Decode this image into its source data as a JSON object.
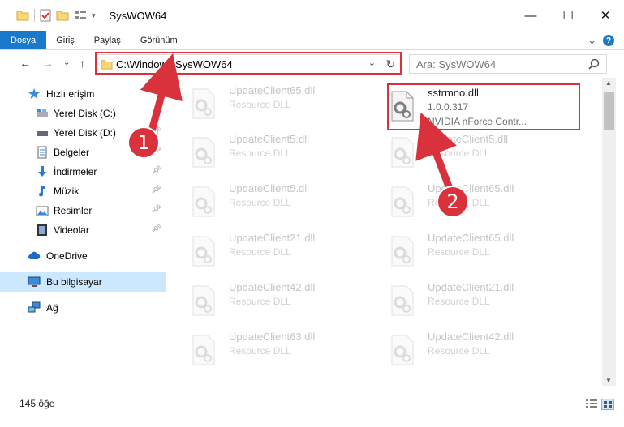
{
  "window": {
    "title": "SysWOW64",
    "minimize": "—",
    "maximize": "☐",
    "close": "✕"
  },
  "ribbon": {
    "tabs": [
      "Dosya",
      "Giriş",
      "Paylaş",
      "Görünüm"
    ],
    "expand": "⌄",
    "help": "?"
  },
  "nav": {
    "back": "←",
    "forward": "→",
    "recent": "⌄",
    "up": "↑"
  },
  "address": {
    "path": "C:\\Windows\\SysWOW64",
    "dropdown": "⌄",
    "refresh": "↻"
  },
  "search": {
    "placeholder": "Ara: SysWOW64"
  },
  "sidebar": {
    "quick_access": "Hızlı erişim",
    "items": [
      {
        "label": "Yerel Disk (C:)",
        "icon": "drive-icon"
      },
      {
        "label": "Yerel Disk (D:)",
        "icon": "drive-icon"
      },
      {
        "label": "Belgeler",
        "icon": "documents-icon"
      },
      {
        "label": "İndirmeler",
        "icon": "download-icon"
      },
      {
        "label": "Müzik",
        "icon": "music-icon"
      },
      {
        "label": "Resimler",
        "icon": "pictures-icon"
      },
      {
        "label": "Videolar",
        "icon": "video-icon"
      }
    ],
    "onedrive": "OneDrive",
    "this_pc": "Bu bilgisayar",
    "network": "Ağ"
  },
  "files": {
    "left": [
      {
        "name": "UpdateClient65.dll",
        "desc": "Resource DLL"
      },
      {
        "name": "UpdateClient5.dll",
        "desc": "Resource DLL"
      },
      {
        "name": "UpdateClient5.dll",
        "desc": "Resource DLL"
      },
      {
        "name": "UpdateClient21.dll",
        "desc": "Resource DLL"
      },
      {
        "name": "UpdateClient42.dll",
        "desc": "Resource DLL"
      },
      {
        "name": "UpdateClient63.dll",
        "desc": "Resource DLL"
      }
    ],
    "highlight": {
      "name": "sstrmno.dll",
      "version": "1.0.0.317",
      "company": "NVIDIA nForce Contr..."
    },
    "right": [
      {
        "name": "UpdateClient5.dll",
        "desc": "Resource DLL"
      },
      {
        "name": "UpdateClient65.dll",
        "desc": "Resource DLL"
      },
      {
        "name": "UpdateClient65.dll",
        "desc": "Resource DLL"
      },
      {
        "name": "UpdateClient21.dll",
        "desc": "Resource DLL"
      },
      {
        "name": "UpdateClient42.dll",
        "desc": "Resource DLL"
      }
    ]
  },
  "status": {
    "count": "145 öğe"
  },
  "callouts": {
    "one": "1",
    "two": "2"
  },
  "colors": {
    "accent": "#1979ca",
    "callout": "#d9323c",
    "selected": "#cce8ff"
  }
}
